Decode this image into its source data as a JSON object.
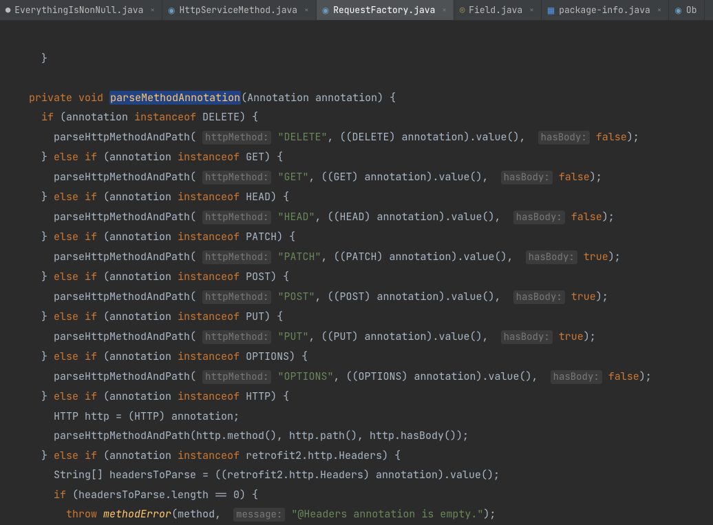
{
  "tabs": [
    {
      "label": "EverythingIsNonNull.java",
      "active": false
    },
    {
      "label": "HttpServiceMethod.java",
      "active": false
    },
    {
      "label": "RequestFactory.java",
      "active": true
    },
    {
      "label": "Field.java",
      "active": false
    },
    {
      "label": "package-info.java",
      "active": false
    },
    {
      "label": "Ob",
      "active": false
    }
  ],
  "code": {
    "line0": "}",
    "sig_pre": "private void ",
    "sig_method": "parseMethodAnnotation",
    "sig_post": "(Annotation annotation) {",
    "if0": "if",
    "elseif": "else if",
    "instof": "instanceof",
    "ann": "annotation",
    "call": "parseHttpMethodAndPath",
    "hm": "httpMethod:",
    "hb": "hasBody:",
    "true": "true",
    "false": "false",
    "methods": {
      "DELETE": "\"DELETE\"",
      "GET": "\"GET\"",
      "HEAD": "\"HEAD\"",
      "PATCH": "\"PATCH\"",
      "POST": "\"POST\"",
      "PUT": "\"PUT\"",
      "OPTIONS": "\"OPTIONS\""
    },
    "types": {
      "DELETE": "DELETE",
      "GET": "GET",
      "HEAD": "HEAD",
      "PATCH": "PATCH",
      "POST": "POST",
      "PUT": "PUT",
      "OPTIONS": "OPTIONS",
      "HTTP": "HTTP",
      "HEADERS": "retrofit2.http.Headers"
    },
    "http_line": "HTTP http = (HTTP) annotation;",
    "http_call": "parseHttpMethodAndPath(http.method(), http.path(), http.hasBody());",
    "headers_line": "String[] headersToParse = ((retrofit2.http.Headers) annotation).value();",
    "headers_if": "if",
    "headers_cond": "(headersToParse.length == 0) {",
    "throw": "throw",
    "methodError": "methodError",
    "throw_post": "(method, ",
    "msg_hint": "message:",
    "msg": "\"@Headers annotation is empty.\"",
    "throw_end": ");"
  }
}
